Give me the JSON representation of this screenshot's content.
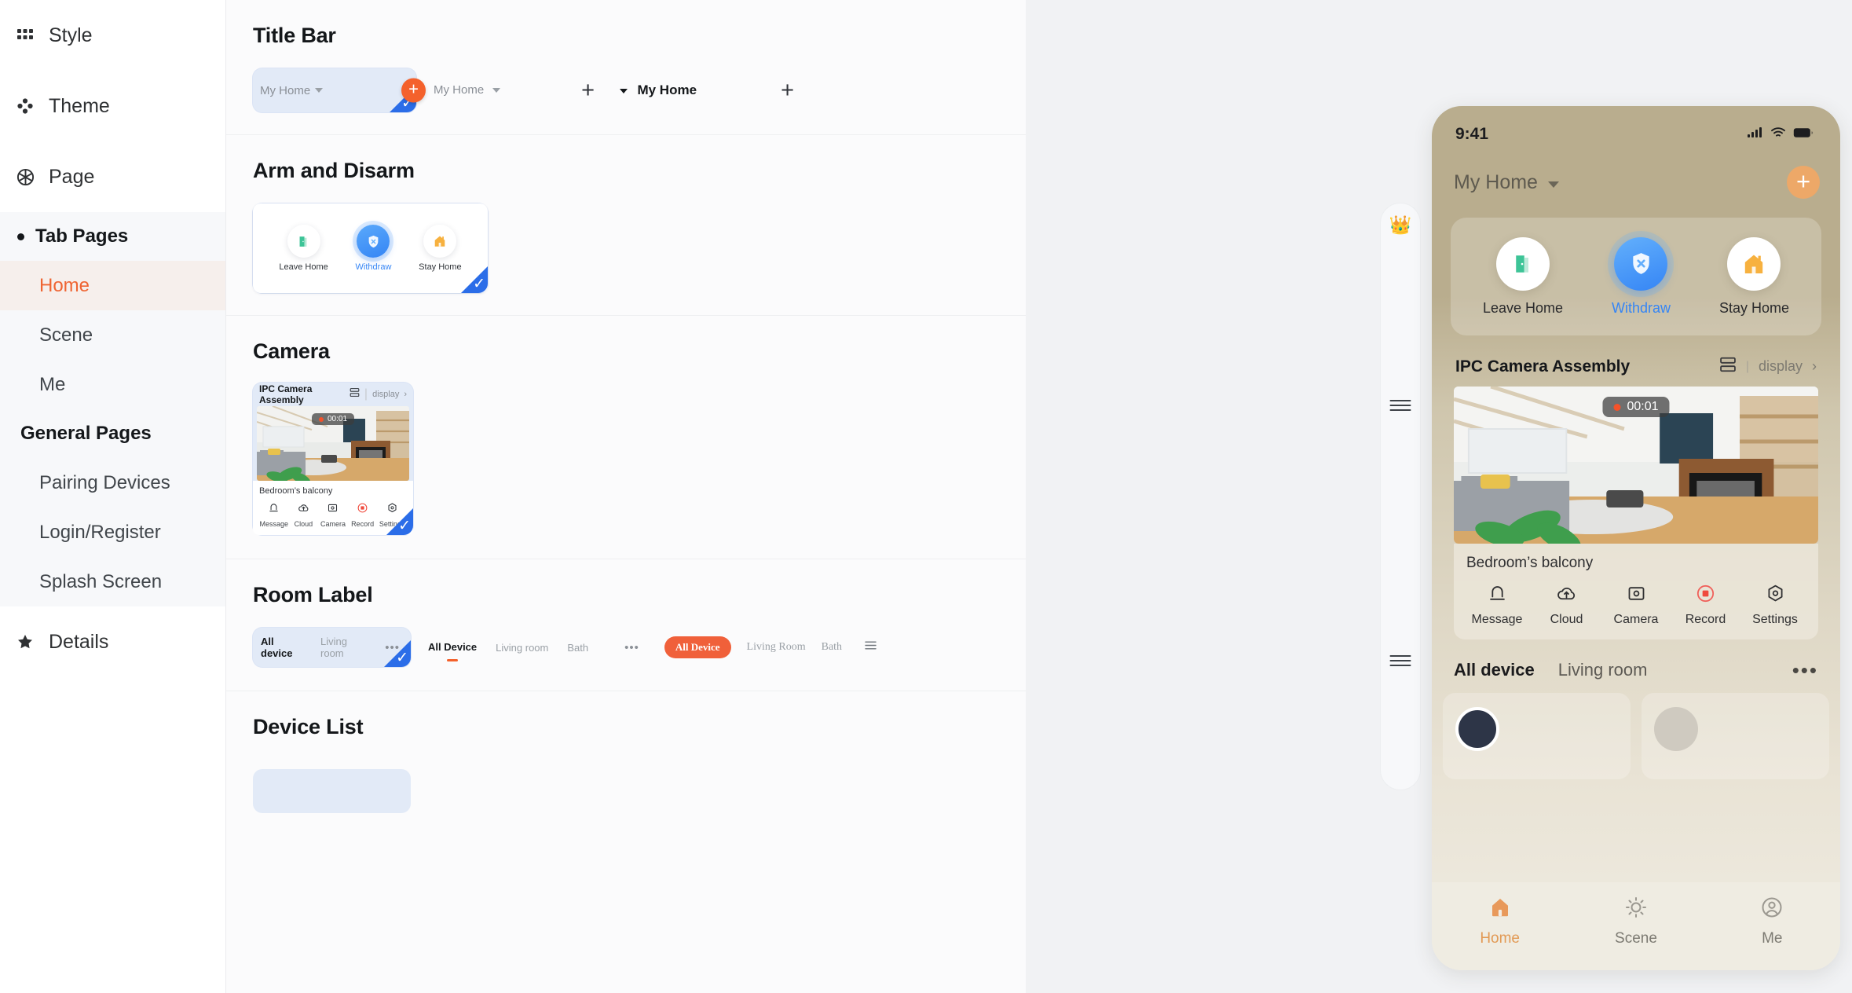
{
  "sidebar": {
    "top_items": [
      {
        "label": "Style",
        "icon": "grid-icon"
      },
      {
        "label": "Theme",
        "icon": "palette-icon"
      },
      {
        "label": "Page",
        "icon": "aperture-icon"
      }
    ],
    "tab_pages_group": {
      "label": "Tab Pages"
    },
    "tab_pages": [
      {
        "label": "Home",
        "active": true
      },
      {
        "label": "Scene",
        "active": false
      },
      {
        "label": "Me",
        "active": false
      }
    ],
    "general_pages_group": {
      "label": "General Pages"
    },
    "general_pages": [
      {
        "label": "Pairing Devices"
      },
      {
        "label": "Login/Register"
      },
      {
        "label": "Splash Screen"
      }
    ],
    "details": {
      "label": "Details",
      "icon": "star-icon"
    }
  },
  "canvas": {
    "sections": {
      "title_bar": {
        "title": "Title Bar",
        "variant1": {
          "home_label": "My Home",
          "add_button": "+"
        },
        "variant2": {
          "home_label": "My Home",
          "add_button": "+"
        },
        "variant3": {
          "home_label": "My Home",
          "add_button": "+"
        }
      },
      "arm_and_disarm": {
        "title": "Arm and Disarm",
        "toggle_on": true,
        "modes": [
          {
            "label": "Leave Home",
            "icon": "door-icon",
            "active": false
          },
          {
            "label": "Withdraw",
            "icon": "shield-x-icon",
            "active": true
          },
          {
            "label": "Stay Home",
            "icon": "house-icon",
            "active": false
          }
        ]
      },
      "camera": {
        "title": "Camera",
        "card_title": "IPC Camera Assembly",
        "layout_icon": "split-layout-icon",
        "display_link": "display",
        "chevron": "›",
        "rec_time": "00:01",
        "room_name": "Bedroom’s balcony",
        "actions": [
          {
            "label": "Message",
            "icon": "bell-icon"
          },
          {
            "label": "Cloud",
            "icon": "cloud-upload-icon"
          },
          {
            "label": "Camera",
            "icon": "camera-icon"
          },
          {
            "label": "Record",
            "icon": "record-stop-icon"
          },
          {
            "label": "Settings",
            "icon": "gear-hex-icon"
          }
        ]
      },
      "room_label": {
        "title": "Room Label",
        "variant1": {
          "tabs": [
            "All device",
            "Living room"
          ],
          "more": "•••"
        },
        "variant2": {
          "tabs": [
            "All Device",
            "Living room",
            "Bath"
          ],
          "more": "•••"
        },
        "variant3": {
          "tabs": [
            "All Device",
            "Living Room",
            "Bath"
          ],
          "menu_icon": "hamburger-icon"
        }
      },
      "device_list": {
        "title": "Device List"
      }
    }
  },
  "tool_rail": {
    "crown": "👑",
    "handles": [
      "drag-handle-1",
      "drag-handle-2"
    ]
  },
  "phone": {
    "status_bar": {
      "time": "9:41",
      "signal_icon": "signal-icon",
      "wifi_icon": "wifi-icon",
      "battery_icon": "battery-icon"
    },
    "header": {
      "home_name": "My Home",
      "add_button": "+"
    },
    "arm_modes": [
      {
        "label": "Leave Home",
        "icon": "door-icon",
        "active": false
      },
      {
        "label": "Withdraw",
        "icon": "shield-x-icon",
        "active": true
      },
      {
        "label": "Stay Home",
        "icon": "house-icon",
        "active": false
      }
    ],
    "camera": {
      "card_title": "IPC Camera Assembly",
      "layout_icon": "split-layout-icon",
      "display_link": "display",
      "chevron": "›",
      "rec_time": "00:01",
      "room_name": "Bedroom’s balcony",
      "actions": [
        {
          "label": "Message",
          "icon": "bell-icon"
        },
        {
          "label": "Cloud",
          "icon": "cloud-upload-icon"
        },
        {
          "label": "Camera",
          "icon": "camera-icon"
        },
        {
          "label": "Record",
          "icon": "record-stop-icon"
        },
        {
          "label": "Settings",
          "icon": "gear-hex-icon"
        }
      ]
    },
    "room_tabs": {
      "tabs": [
        "All device",
        "Living room"
      ],
      "more": "•••"
    },
    "tab_bar": [
      {
        "label": "Home",
        "icon": "home-icon",
        "active": true
      },
      {
        "label": "Scene",
        "icon": "sun-icon",
        "active": false
      },
      {
        "label": "Me",
        "icon": "person-icon",
        "active": false
      }
    ]
  },
  "colors": {
    "accent_orange": "#ef6432",
    "selection_blue": "#2b6de8",
    "toggle_blue": "#1a53de",
    "active_mode_blue": "#3585f5",
    "pill_orange": "#f0603a",
    "phone_bg": "#b9ad8e",
    "phone_tab_active": "#e29a55"
  }
}
